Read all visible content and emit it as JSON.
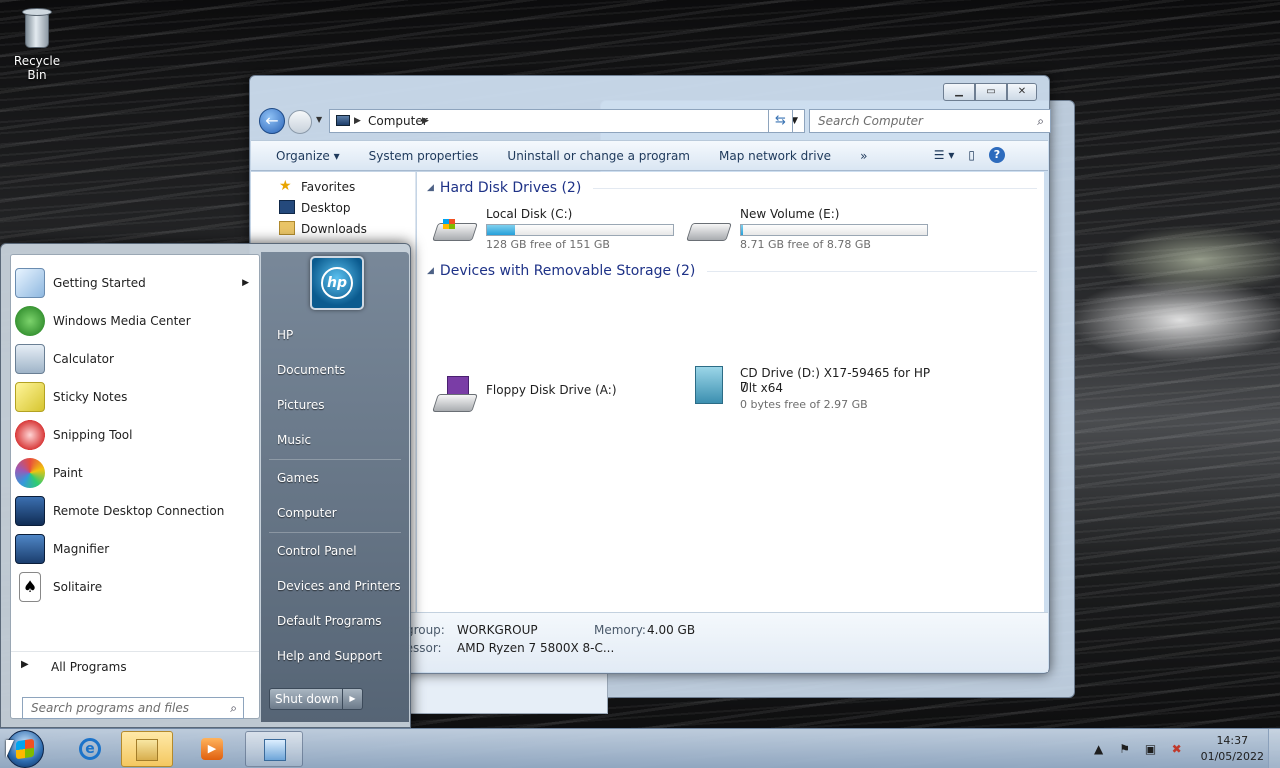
{
  "desktop": {
    "icons": [
      {
        "label": "Recycle Bin",
        "icon": "recycle-bin-icon"
      }
    ]
  },
  "explorer": {
    "address": {
      "root": "Computer"
    },
    "search_placeholder": "Search Computer",
    "toolbar": {
      "organize": "Organize",
      "system_properties": "System properties",
      "uninstall": "Uninstall or change a program",
      "map_network": "Map network drive",
      "more": "»"
    },
    "nav": {
      "favorites": "Favorites",
      "desktop": "Desktop",
      "downloads": "Downloads"
    },
    "groups": [
      {
        "title": "Hard Disk Drives (2)",
        "drives": [
          {
            "name": "Local Disk (C:)",
            "free": "128 GB free of 151 GB",
            "used_fraction": 0.15,
            "icon": "windows-drive-icon"
          },
          {
            "name": "New Volume (E:)",
            "free": "8.71 GB free of 8.78 GB",
            "used_fraction": 0.01,
            "icon": "hard-drive-icon"
          }
        ]
      },
      {
        "title": "Devices with Removable Storage (2)",
        "drives": [
          {
            "name": "Floppy Disk Drive (A:)",
            "icon": "floppy-drive-icon"
          },
          {
            "name": "CD Drive (D:) X17-59465 for HP 7",
            "name2": "Ult x64",
            "free": "0 bytes free of 2.97 GB",
            "icon": "cd-drive-icon"
          }
        ]
      }
    ],
    "details": {
      "workgroup_label": "kgroup:",
      "workgroup_value": "WORKGROUP",
      "memory_label": "Memory:",
      "memory_value": "4.00 GB",
      "processor_label": "cessor:",
      "processor_value": "AMD Ryzen 7 5800X 8-C..."
    }
  },
  "start_menu": {
    "programs": [
      {
        "label": "Getting Started",
        "icon": "getting-started-icon",
        "submenu": true
      },
      {
        "label": "Windows Media Center",
        "icon": "media-center-icon"
      },
      {
        "label": "Calculator",
        "icon": "calculator-icon"
      },
      {
        "label": "Sticky Notes",
        "icon": "sticky-notes-icon"
      },
      {
        "label": "Snipping Tool",
        "icon": "snipping-tool-icon"
      },
      {
        "label": "Paint",
        "icon": "paint-icon"
      },
      {
        "label": "Remote Desktop Connection",
        "icon": "remote-desktop-icon"
      },
      {
        "label": "Magnifier",
        "icon": "magnifier-icon"
      },
      {
        "label": "Solitaire",
        "icon": "solitaire-icon"
      }
    ],
    "all_programs": "All Programs",
    "search_placeholder": "Search programs and files",
    "user_logo": "hp",
    "right_links": [
      "HP",
      "Documents",
      "Pictures",
      "Music",
      "Games",
      "Computer",
      "Control Panel",
      "Devices and Printers",
      "Default Programs",
      "Help and Support"
    ],
    "shutdown": "Shut down"
  },
  "taskbar": {
    "apps": [
      "internet-explorer-icon",
      "windows-explorer-icon",
      "media-player-icon",
      "control-panel-icon"
    ],
    "clock_time": "14:37",
    "clock_date": "01/05/2022"
  },
  "colors": {
    "accent": "#1e3287",
    "drive_fill": "#26a0da",
    "taskbar_active": "#f4c860"
  }
}
